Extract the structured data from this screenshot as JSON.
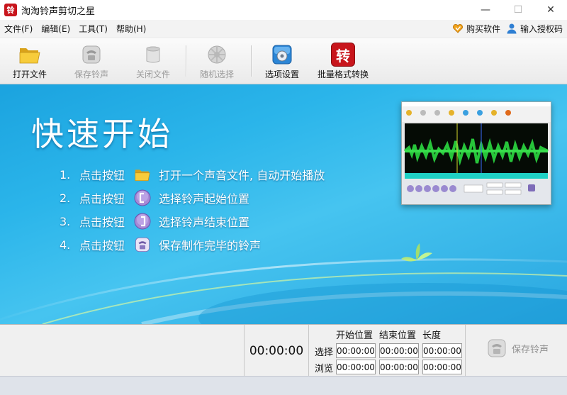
{
  "window": {
    "title": "淘淘铃声剪切之星",
    "logo_char": "铃",
    "minimize": "—",
    "maximize": "☐",
    "close": "✕"
  },
  "menu": {
    "items": [
      "文件(F)",
      "编辑(E)",
      "工具(T)",
      "帮助(H)"
    ],
    "buy_label": "购买软件",
    "register_label": "输入授权码"
  },
  "toolbar": {
    "open": "打开文件",
    "save": "保存铃声",
    "close": "关闭文件",
    "random": "随机选择",
    "options": "选项设置",
    "batch": "批量格式转换",
    "batch_icon_char": "转"
  },
  "banner": {
    "title": "快速开始",
    "steps": [
      {
        "num": "1.",
        "action": "点击按钮",
        "desc": "打开一个声音文件, 自动开始播放"
      },
      {
        "num": "2.",
        "action": "点击按钮",
        "desc": "选择铃声起始位置"
      },
      {
        "num": "3.",
        "action": "点击按钮",
        "desc": "选择铃声结束位置"
      },
      {
        "num": "4.",
        "action": "点击按钮",
        "desc": "保存制作完毕的铃声"
      }
    ],
    "colors": {
      "sky_top": "#1ba3df",
      "sky_mid": "#46c4f0",
      "wave_green": "#27c43a"
    }
  },
  "bottom": {
    "current_time": "00:00:00",
    "headers": [
      "开始位置",
      "结束位置",
      "长度"
    ],
    "rows": [
      {
        "label": "选择",
        "values": [
          "00:00:00",
          "00:00:00",
          "00:00:00"
        ]
      },
      {
        "label": "浏览",
        "values": [
          "00:00:00",
          "00:00:00",
          "00:00:00"
        ]
      }
    ],
    "save_label": "保存铃声"
  }
}
